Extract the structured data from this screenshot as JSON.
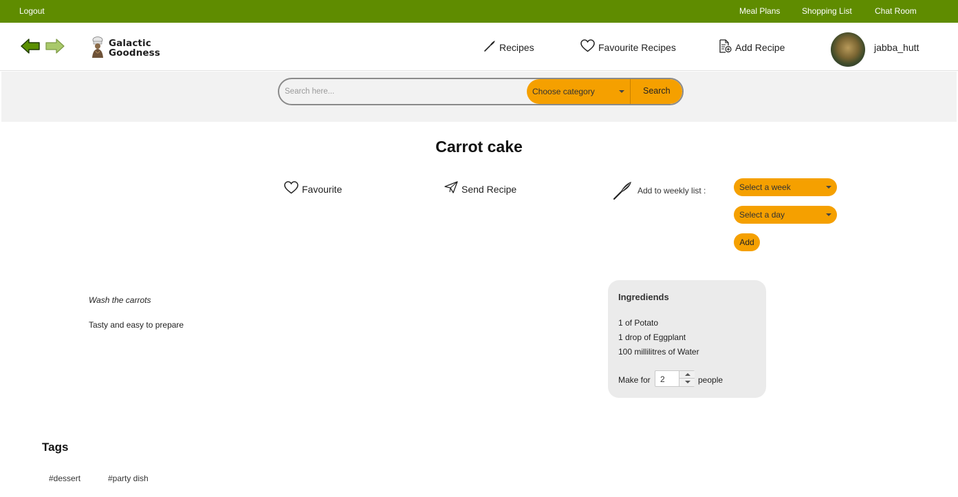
{
  "topbar": {
    "logout": "Logout",
    "links": [
      "Meal Plans",
      "Shopping List",
      "Chat Room"
    ]
  },
  "header": {
    "back_icon": "arrow-left-icon",
    "forward_icon": "arrow-right-icon",
    "logo": {
      "line1": "Galactic",
      "line2": "Goodness",
      "icon": "chef-icon"
    },
    "nav": [
      {
        "label": "Recipes",
        "icon": "whisk-icon"
      },
      {
        "label": "Favourite Recipes",
        "icon": "heart-icon"
      },
      {
        "label": "Add Recipe",
        "icon": "add-document-icon"
      }
    ],
    "user": {
      "name": "jabba_hutt"
    }
  },
  "search": {
    "placeholder": "Search here...",
    "category_label": "Choose category",
    "button_label": "Search"
  },
  "recipe": {
    "title": "Carrot cake",
    "favourite_label": "Favourite",
    "send_label": "Send Recipe",
    "weekly_label": "Add to weekly list :",
    "week_select": "Select a week",
    "day_select": "Select a day",
    "add_label": "Add",
    "instruction": "Wash the carrots",
    "description": "Tasty and easy to prepare"
  },
  "ingredients": {
    "heading": "Ingrediends",
    "items": [
      "1  of Potato",
      "1 drop of Eggplant",
      "100 millilitres of Water"
    ],
    "make_for_label": "Make for",
    "people_count": "2",
    "people_label": "people"
  },
  "tags": {
    "heading": "Tags",
    "items": [
      "#dessert",
      "#party dish"
    ]
  },
  "colors": {
    "topbar": "#5f8c00",
    "accent": "#f5a000",
    "band": "#f2f2f2",
    "ingredient_box": "#ebebeb"
  }
}
